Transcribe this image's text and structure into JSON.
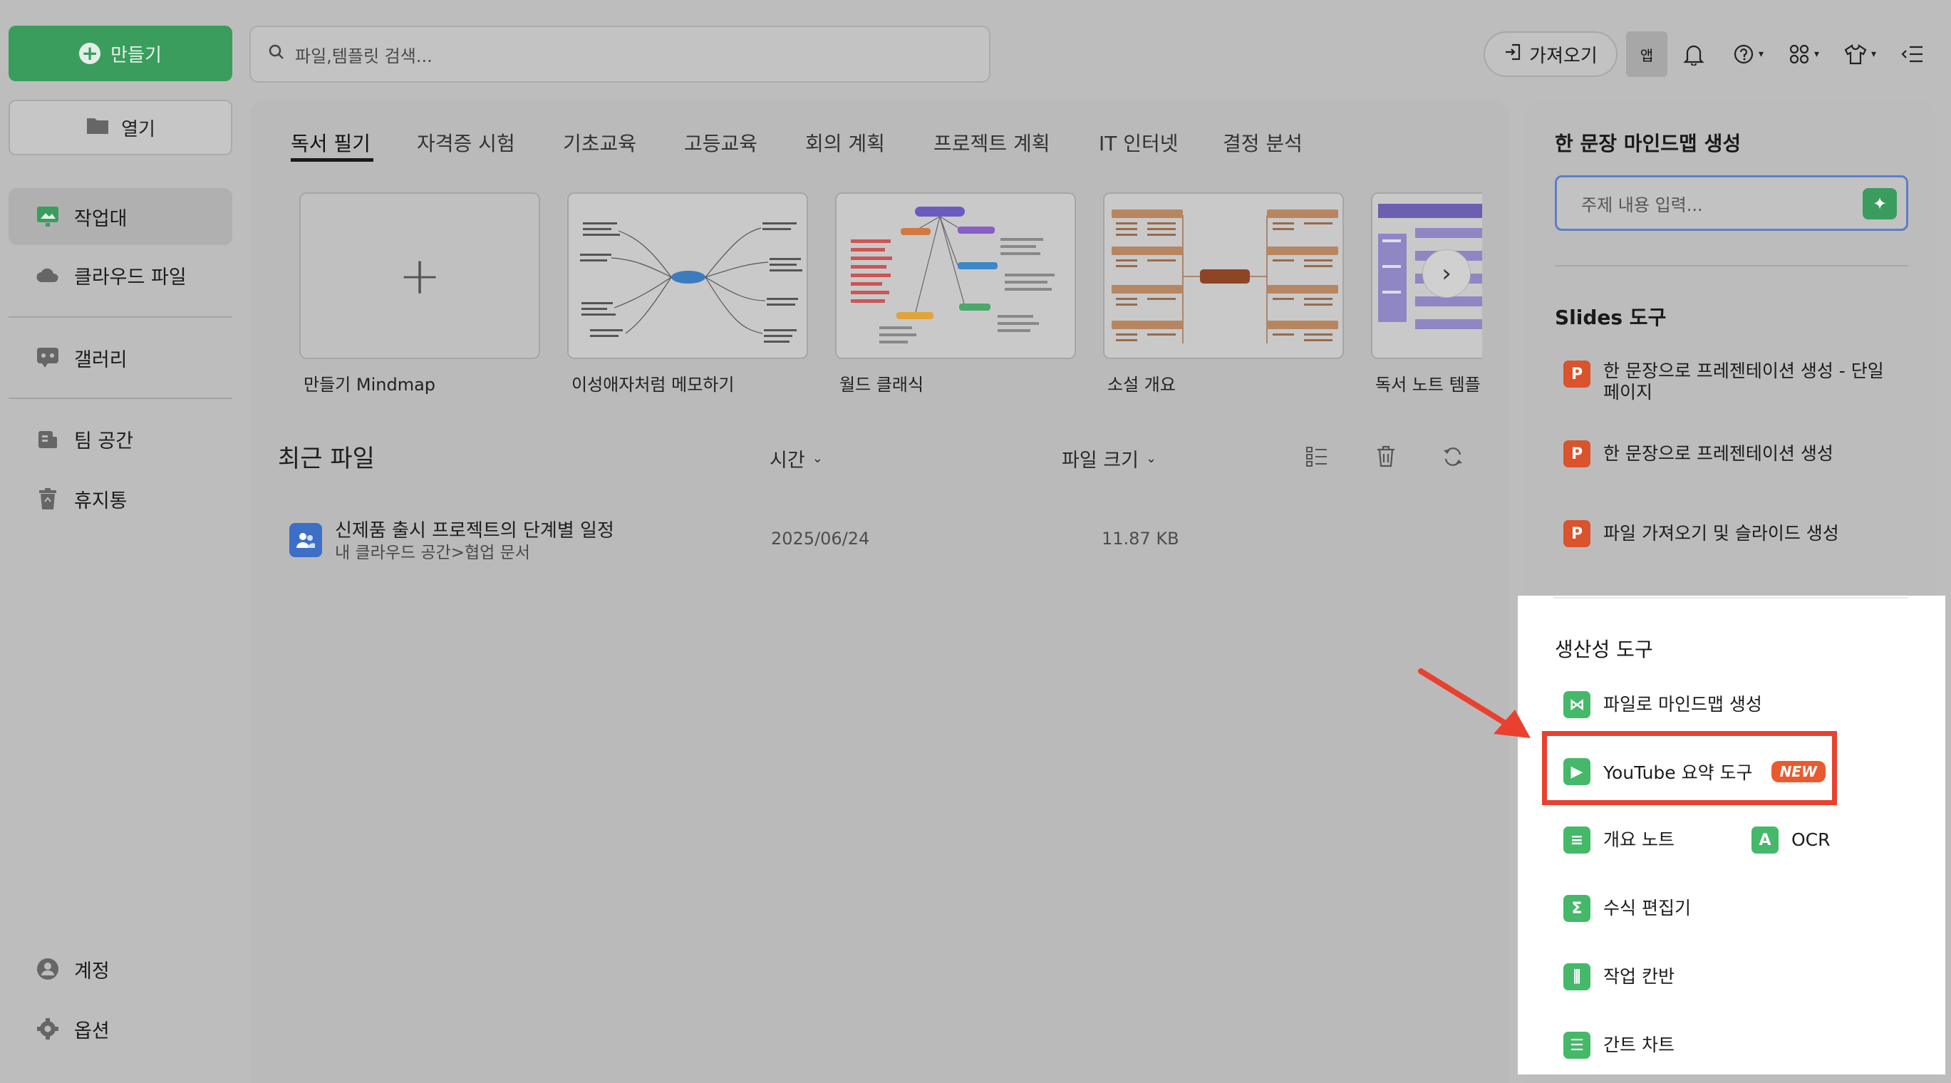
{
  "sidebar": {
    "create_label": "만들기",
    "open_label": "열기",
    "items": [
      {
        "label": "작업대"
      },
      {
        "label": "클라우드 파일"
      },
      {
        "label": "갤러리"
      },
      {
        "label": "팀 공간"
      },
      {
        "label": "휴지통"
      }
    ],
    "bottom": [
      {
        "label": "계정"
      },
      {
        "label": "옵션"
      }
    ]
  },
  "topbar": {
    "search_placeholder": "파일,템플릿 검색...",
    "import_label": "가져오기",
    "app_label": "앱"
  },
  "tabs": [
    "독서 필기",
    "자격증 시험",
    "기초교육",
    "고등교육",
    "회의 계획",
    "프로젝트 계획",
    "IT 인터넷",
    "결정 분석"
  ],
  "templates": [
    {
      "label": "만들기 Mindmap"
    },
    {
      "label": "이성애자처럼 메모하기"
    },
    {
      "label": "월드 클래식"
    },
    {
      "label": "소설 개요"
    },
    {
      "label": "독서 노트 템플"
    }
  ],
  "recent": {
    "title": "최근 파일",
    "col_time": "시간",
    "col_size": "파일 크기",
    "files": [
      {
        "name": "신제품 출시 프로젝트의 단계별 일정",
        "path": "내 클라우드 공간>협업 문서",
        "date": "2025/06/24",
        "size": "11.87 KB"
      }
    ]
  },
  "right_panel": {
    "mindmap_title": "한 문장 마인드맵 생성",
    "topic_placeholder": "주제 내용 입력...",
    "slides_title": "Slides 도구",
    "slides_tools": [
      {
        "label": "한 문장으로 프레젠테이션 생성 - 단일 페이지"
      },
      {
        "label": "한 문장으로 프레젠테이션 생성"
      },
      {
        "label": "파일 가져오기 및 슬라이드 생성"
      }
    ],
    "productivity_title": "생산성 도구",
    "productivity_tools": [
      {
        "label": "파일로 마인드맵 생성"
      },
      {
        "label": "YouTube 요약 도구",
        "badge": "NEW"
      },
      {
        "label": "개요 노트"
      },
      {
        "label": "OCR"
      },
      {
        "label": "수식 편집기"
      },
      {
        "label": "작업 칸반"
      },
      {
        "label": "간트 차트"
      }
    ]
  },
  "colors": {
    "accent_green": "#3a9d5d",
    "highlight_red": "#e8412f",
    "badge_orange": "#ea5a2e",
    "ppt_orange": "#d9532c"
  }
}
